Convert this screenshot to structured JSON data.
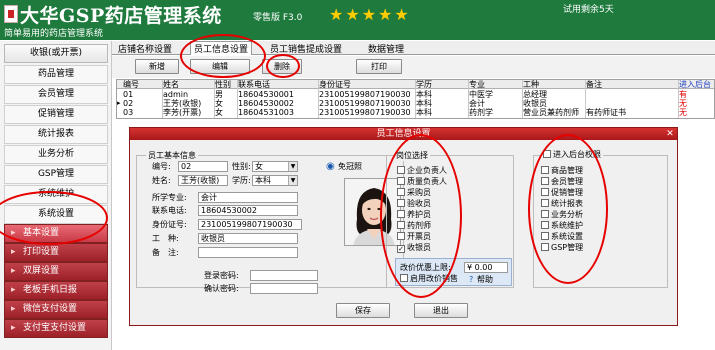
{
  "header": {
    "title": "大华GSP药店管理系统",
    "edition": "零售版 F3.0",
    "stars": "★★★★★",
    "subtitle": "简单易用的药店管理系统",
    "trial_text": "试用剩余5天"
  },
  "sidebar": {
    "top_label": "收银(或开票)",
    "items": [
      "药品管理",
      "会员管理",
      "促销管理",
      "统计报表",
      "业务分析",
      "GSP管理",
      "系统维护",
      "系统设置"
    ],
    "red_items": [
      "基本设置",
      "打印设置",
      "双屏设置",
      "老板手机日报",
      "微信支付设置",
      "支付宝支付设置"
    ]
  },
  "tabs": [
    "店铺名称设置",
    "员工信息设置",
    "员工销售提成设置",
    "数据管理"
  ],
  "toolbar": {
    "new_label": "新增",
    "edit_label": "编辑",
    "delete_label": "删除",
    "print_label": "打印"
  },
  "table": {
    "columns": [
      "编号",
      "姓名",
      "性别",
      "联系电话",
      "身份证号",
      "学历",
      "专业",
      "工种",
      "备注",
      "进入后台"
    ],
    "rows": [
      [
        "01",
        "admin",
        "男",
        "18604530001",
        "231005199807190030",
        "本科",
        "中医学",
        "总经理",
        "",
        "有"
      ],
      [
        "02",
        "王芳(收银)",
        "女",
        "18604530002",
        "231005199807190030",
        "本科",
        "会计",
        "收银员",
        "",
        "无"
      ],
      [
        "03",
        "李芳(开票)",
        "女",
        "18604531003",
        "231005199807190030",
        "本科",
        "药剂学",
        "营业员兼药剂师",
        "有药师证书",
        "无"
      ]
    ]
  },
  "dialog": {
    "title": "员工信息设置",
    "basic_group": "员工基本信息",
    "id_label": "编号:",
    "id_value": "02",
    "gender_label": "性别:",
    "gender_value": "女",
    "name_label": "姓名:",
    "name_value": "王芳(收银)",
    "education_label": "学历:",
    "education_value": "本科",
    "major_label": "所学专业:",
    "major_value": "会计",
    "phone_label": "联系电话:",
    "phone_value": "18604530002",
    "idcard_label": "身份证号:",
    "idcard_value": "231005199807190030",
    "work_label": "工　种:",
    "work_value": "收银员",
    "remark_label": "备　注:",
    "remark_value": "",
    "login_pw_label": "登录密码:",
    "confirm_pw_label": "确认密码:",
    "camera_label": "免冠照",
    "position_group": "岗位选择",
    "positions": [
      {
        "label": "企业负责人",
        "checked": false
      },
      {
        "label": "质量负责人",
        "checked": false
      },
      {
        "label": "采购员",
        "checked": false
      },
      {
        "label": "验收员",
        "checked": false
      },
      {
        "label": "养护员",
        "checked": false
      },
      {
        "label": "药剂师",
        "checked": false
      },
      {
        "label": "开票员",
        "checked": false
      },
      {
        "label": "收银员",
        "checked": true
      }
    ],
    "discount_label": "改价优惠上限:",
    "discount_value": "¥ 0.00",
    "enable_discount_label": "启用改价销售",
    "help_label": "帮助",
    "backend_group": "进入后台权限",
    "permissions": [
      "商品管理",
      "会员管理",
      "促销管理",
      "统计报表",
      "业务分析",
      "系统维护",
      "系统设置",
      "GSP管理"
    ],
    "save_label": "保存",
    "exit_label": "退出"
  }
}
